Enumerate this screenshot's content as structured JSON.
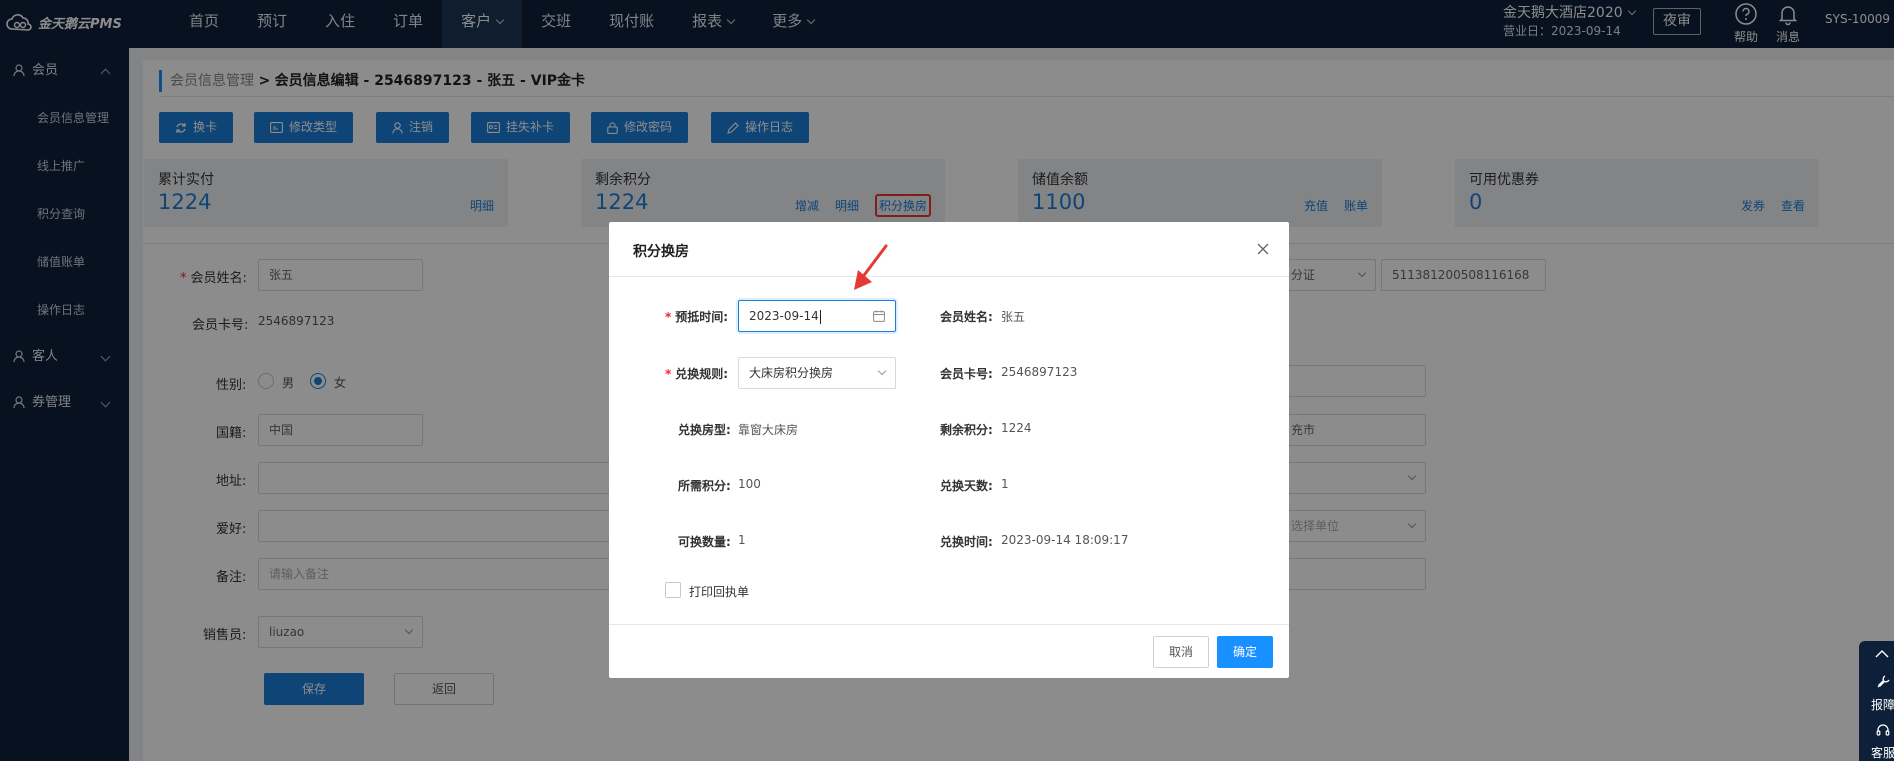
{
  "app": {
    "logo_text": "金天鹅云PMS"
  },
  "topnav": {
    "items": [
      {
        "label": "首页",
        "dropdown": false,
        "active": false
      },
      {
        "label": "预订",
        "dropdown": false,
        "active": false
      },
      {
        "label": "入住",
        "dropdown": false,
        "active": false
      },
      {
        "label": "订单",
        "dropdown": false,
        "active": false
      },
      {
        "label": "客户",
        "dropdown": true,
        "active": true
      },
      {
        "label": "交班",
        "dropdown": false,
        "active": false
      },
      {
        "label": "现付账",
        "dropdown": false,
        "active": false
      },
      {
        "label": "报表",
        "dropdown": true,
        "active": false
      },
      {
        "label": "更多",
        "dropdown": true,
        "active": false
      }
    ],
    "hotel_name": "金天鹅大酒店2020",
    "business_date": "营业日：2023-09-14",
    "night_audit": "夜审",
    "help": "帮助",
    "messages": "消息",
    "user": "SYS-10009"
  },
  "sidebar": {
    "groups": [
      {
        "label": "会员",
        "expanded": true,
        "items": [
          "会员信息管理",
          "线上推广",
          "积分查询",
          "储值账单",
          "操作日志"
        ]
      },
      {
        "label": "客人",
        "expanded": false
      },
      {
        "label": "券管理",
        "expanded": false
      }
    ]
  },
  "breadcrumb": {
    "parent": "会员信息管理",
    "separator": ">",
    "current": "会员信息编辑 - 2546897123 - 张五 - VIP金卡"
  },
  "actions": [
    "换卡",
    "修改类型",
    "注销",
    "挂失补卡",
    "修改密码",
    "操作日志"
  ],
  "cards": [
    {
      "title": "累计实付",
      "value": "1224",
      "links": [
        "明细"
      ]
    },
    {
      "title": "剩余积分",
      "value": "1224",
      "links": [
        "增减",
        "明细",
        "积分换房"
      ]
    },
    {
      "title": "储值余额",
      "value": "1100",
      "links": [
        "充值",
        "账单"
      ]
    },
    {
      "title": "可用优惠券",
      "value": "0",
      "links": [
        "发券",
        "查看"
      ]
    }
  ],
  "form": {
    "name_label": "会员姓名:",
    "name_value": "张五",
    "card_label": "会员卡号:",
    "card_value": "2546897123",
    "gender_label": "性别:",
    "gender_male": "男",
    "gender_female": "女",
    "gender_selected": "女",
    "nationality_label": "国籍:",
    "nationality_value": "中国",
    "address_label": "地址:",
    "hobby_label": "爱好:",
    "remark_label": "备注:",
    "remark_placeholder": "请输入备注",
    "sales_label": "销售员:",
    "sales_value": "liuzao",
    "id_type_value": "分证",
    "id_number_value": "511381200508116168",
    "city_fragment": "充市",
    "unit_placeholder_fragment": "选择单位",
    "save": "保存",
    "back": "返回"
  },
  "modal": {
    "title": "积分换房",
    "fields": {
      "date_label": "预抵时间:",
      "date_value": "2023-09-14",
      "rule_label": "兑换规则:",
      "rule_value": "大床房积分换房",
      "roomtype_label": "兑换房型:",
      "roomtype_value": "靠窗大床房",
      "points_needed_label": "所需积分:",
      "points_needed_value": "100",
      "count_label": "可换数量:",
      "count_value": "1",
      "member_name_label": "会员姓名:",
      "member_name_value": "张五",
      "member_card_label": "会员卡号:",
      "member_card_value": "2546897123",
      "remaining_points_label": "剩余积分:",
      "remaining_points_value": "1224",
      "days_label": "兑换天数:",
      "days_value": "1",
      "exchange_time_label": "兑换时间:",
      "exchange_time_value": "2023-09-14 18:09:17"
    },
    "print_receipt": "打印回执单",
    "cancel": "取消",
    "confirm": "确定"
  },
  "float_toolbar": {
    "items": [
      "报障",
      "客服"
    ]
  },
  "colors": {
    "brand": "#1a7fd7",
    "nav_bg": "#0e1f3a",
    "highlight": "#e53935",
    "primary_button": "#1890ff"
  }
}
